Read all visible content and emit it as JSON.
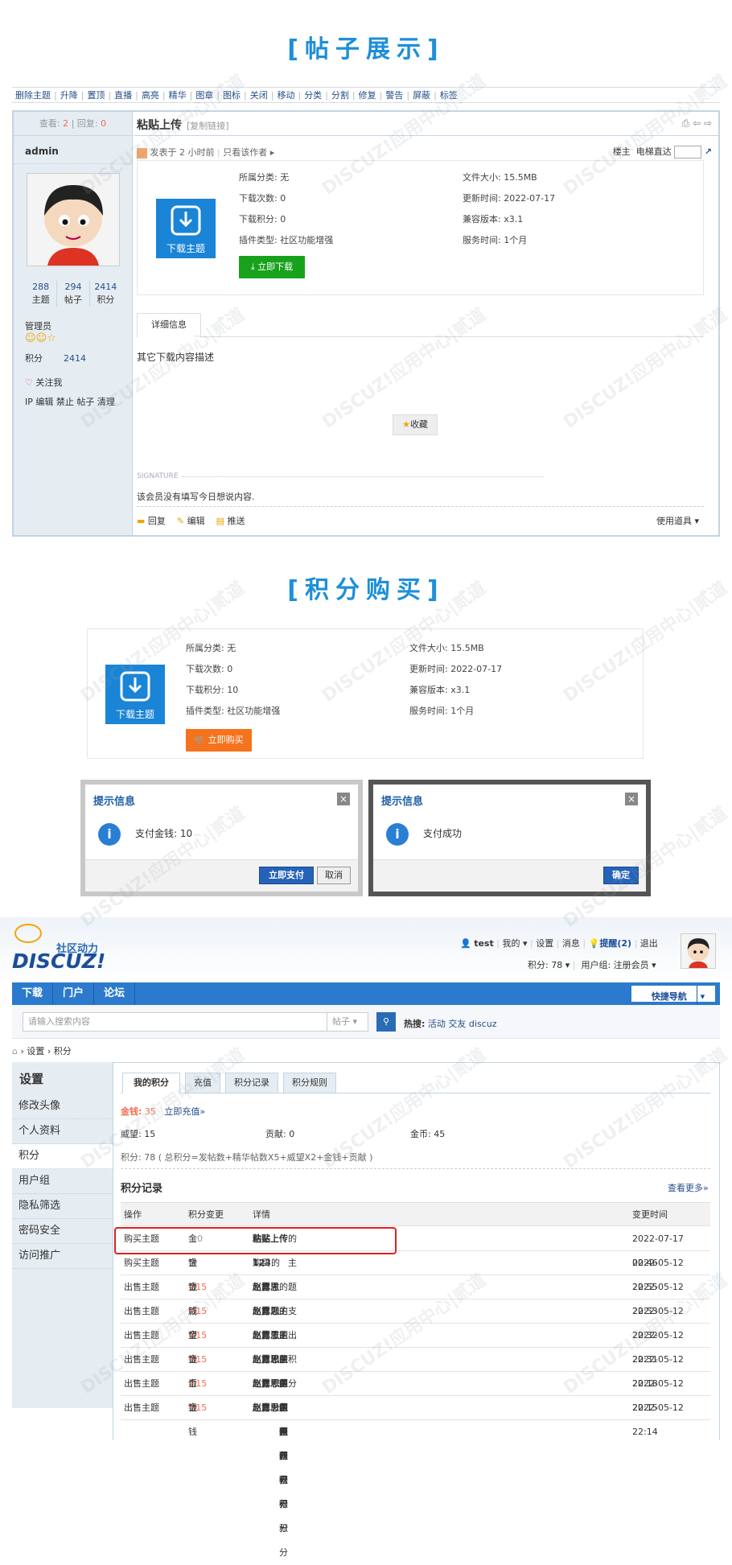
{
  "section1": {
    "title": "[帖子展示]"
  },
  "toolbar": [
    "删除主题",
    "升降",
    "置顶",
    "直播",
    "高亮",
    "精华",
    "图章",
    "图标",
    "关闭",
    "移动",
    "分类",
    "分割",
    "修复",
    "警告",
    "屏蔽",
    "标签"
  ],
  "post": {
    "views_label": "查看:",
    "views": "2",
    "replies_label": "回复:",
    "replies": "0",
    "title": "粘贴上传",
    "copy_link": "[复制链接]",
    "author": "admin",
    "stats": [
      {
        "value": "288",
        "label": "主题"
      },
      {
        "value": "294",
        "label": "帖子"
      },
      {
        "value": "2414",
        "label": "积分"
      }
    ],
    "group": "管理员",
    "score_label": "积分",
    "score": "2414",
    "follow": "关注我",
    "admin_links": "IP 编辑 禁止 帖子 清理",
    "posted": "发表于 2 小时前",
    "only_author": "只看该作者",
    "floor": "楼主",
    "elevator": "电梯直达",
    "download": {
      "icon_label": "下载主题",
      "category": "所属分类: 无",
      "downloads": "下载次数: 0",
      "credits": "下载积分: 0",
      "plugin_type": "插件类型: 社区功能增强",
      "size": "文件大小: 15.5MB",
      "updated": "更新时间: 2022-07-17",
      "compat": "兼容版本: x3.1",
      "service": "服务时间: 1个月",
      "button": "立即下载"
    },
    "tab_detail": "详细信息",
    "content": "其它下载内容描述",
    "favorite": "收藏",
    "signature_label": "SIGNATURE",
    "signature": "该会员没有填写今日想说内容.",
    "actions": {
      "reply": "回复",
      "edit": "编辑",
      "recommend": "推送",
      "tools": "使用道具"
    }
  },
  "section2": {
    "title": "[积分购买]"
  },
  "purchase": {
    "icon_label": "下载主题",
    "category": "所属分类: 无",
    "downloads": "下载次数: 0",
    "credits": "下载积分: 10",
    "plugin_type": "插件类型: 社区功能增强",
    "size": "文件大小: 15.5MB",
    "updated": "更新时间: 2022-07-17",
    "compat": "兼容版本: x3.1",
    "service": "服务时间: 1个月",
    "button": "立即购买"
  },
  "dialog1": {
    "title": "提示信息",
    "message": "支付金钱: 10",
    "confirm": "立即支付",
    "cancel": "取消"
  },
  "dialog2": {
    "title": "提示信息",
    "message": "支付成功",
    "confirm": "确定"
  },
  "site": {
    "slogan": "社区动力",
    "logo": "DISCUZ!",
    "user": "test",
    "my": "我的",
    "settings": "设置",
    "messages": "消息",
    "remind": "提醒(2)",
    "logout": "退出",
    "credits": "积分: 78",
    "usergroup": "用户组: 注册会员"
  },
  "nav": {
    "items": [
      "下载",
      "门户",
      "论坛"
    ],
    "quick": "快捷导航"
  },
  "search": {
    "placeholder": "请输入搜索内容",
    "type": "帖子",
    "hot_label": "热搜:",
    "hot": [
      "活动",
      "交友",
      "discuz"
    ]
  },
  "breadcrumb": [
    "设置",
    "积分"
  ],
  "sidebar": {
    "title": "设置",
    "items": [
      "修改头像",
      "个人资料",
      "积分",
      "用户组",
      "隐私筛选",
      "密码安全",
      "访问推广"
    ]
  },
  "tabs": [
    "我的积分",
    "充值",
    "积分记录",
    "积分规则"
  ],
  "mycredits": {
    "money_label": "金钱:",
    "money": "35",
    "recharge": "立即充值»",
    "prestige": "威望: 15",
    "contribution": "贡献: 0",
    "gold": "金币: 45",
    "formula": "积分: 78 ( 总积分=发帖数+精华帖数X5+威望X2+金钱+贡献 )"
  },
  "records": {
    "title": "积分记录",
    "more": "查看更多»",
    "headers": [
      "操作",
      "积分变更",
      "详情",
      "变更时间"
    ],
    "rows": [
      {
        "op": "购买主题",
        "type": "金钱",
        "change": "-10",
        "pre": "购买",
        "topic": "粘贴上传",
        "post": "的主题支出积分",
        "time": "2022-07-17 02:46"
      },
      {
        "op": "购买主题",
        "type": "金钱",
        "change": "-5",
        "pre": "购买",
        "topic": "123",
        "post": "的主题支出积分",
        "time": "2022-05-12 22:55"
      },
      {
        "op": "出售主题",
        "type": "金钱",
        "change": "+15",
        "pre": "出售",
        "topic": "赵露思",
        "post": "的主题获得积分",
        "time": "2022-05-12 22:53"
      },
      {
        "op": "出售主题",
        "type": "威望",
        "change": "+15",
        "pre": "出售",
        "topic": "赵露思",
        "post": "的主题获得积分",
        "time": "2022-05-12 22:32"
      },
      {
        "op": "出售主题",
        "type": "金钱",
        "change": "+15",
        "pre": "出售",
        "topic": "赵露思",
        "post": "的主题获得积分",
        "time": "2022-05-12 22:31"
      },
      {
        "op": "出售主题",
        "type": "金币",
        "change": "+15",
        "pre": "出售",
        "topic": "赵露思",
        "post": "的主题获得积分",
        "time": "2022-05-12 22:18"
      },
      {
        "op": "出售主题",
        "type": "金钱",
        "change": "+15",
        "pre": "出售",
        "topic": "赵露思",
        "post": "的主题获得积分",
        "time": "2022-05-12 22:15"
      },
      {
        "op": "出售主题",
        "type": "金钱",
        "change": "+15",
        "pre": "出售",
        "topic": "赵露思",
        "post": "的主题获得积分",
        "time": "2022-05-12 22:14"
      }
    ]
  }
}
